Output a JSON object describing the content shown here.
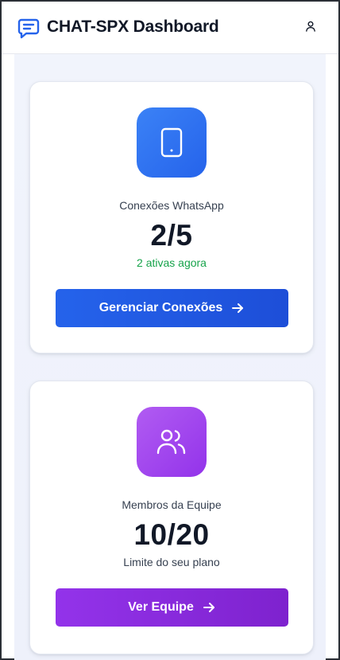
{
  "header": {
    "title": "CHAT-SPX Dashboard",
    "logo_icon": "chat-bubble-icon",
    "profile_icon": "user-icon"
  },
  "cards": [
    {
      "icon": "smartphone-icon",
      "label": "Conexões WhatsApp",
      "value": "2/5",
      "subtext": "2 ativas agora",
      "button_label": "Gerenciar Conexões",
      "accent": "#2563eb",
      "subtext_color": "#16a34a"
    },
    {
      "icon": "users-icon",
      "label": "Membros da Equipe",
      "value": "10/20",
      "subtext": "Limite do seu plano",
      "button_label": "Ver Equipe",
      "accent": "#9333ea",
      "subtext_color": "#374151"
    }
  ]
}
